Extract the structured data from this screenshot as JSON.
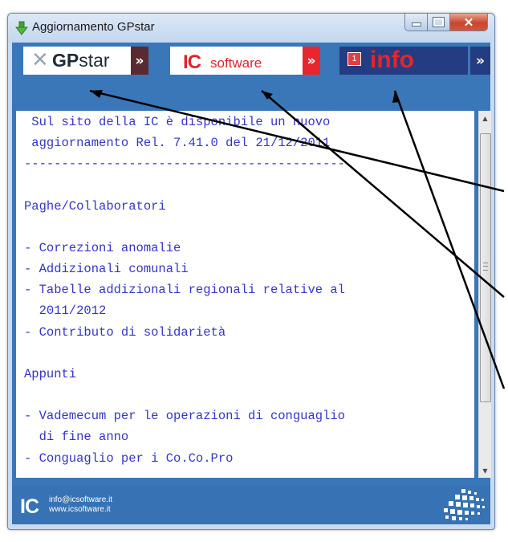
{
  "window": {
    "title": "Aggiornamento GPstar"
  },
  "banner": {
    "tabs": [
      {
        "label_brand_bold": "GP",
        "label_brand": "star",
        "chevron": "»"
      },
      {
        "logo": "IC",
        "label": "software",
        "chevron": "»"
      },
      {
        "badge": "1",
        "label": "info",
        "chevron": "»"
      }
    ]
  },
  "content": {
    "lines": [
      " Sul sito della IC è disponibile un nuovo",
      " aggiornamento Rel. 7.41.0 del 21/12/2011",
      "-------------------------------------------",
      "",
      "Paghe/Collaboratori",
      "",
      "- Correzioni anomalie",
      "- Addizionali comunali",
      "- Tabelle addizionali regionali relative al",
      "  2011/2012",
      "- Contributo di solidarietà",
      "",
      "Appunti",
      "",
      "- Vademecum per le operazioni di conguaglio",
      "  di fine anno",
      "- Conguaglio per i Co.Co.Pro"
    ]
  },
  "footer": {
    "logo": "IC",
    "email": "info@icsoftware.it",
    "website": "www.icsoftware.it"
  },
  "colors": {
    "banner_blue": "#3a77b8",
    "text_blue": "#3535c8",
    "ic_red": "#e2232a",
    "info_navy": "#243c82"
  }
}
